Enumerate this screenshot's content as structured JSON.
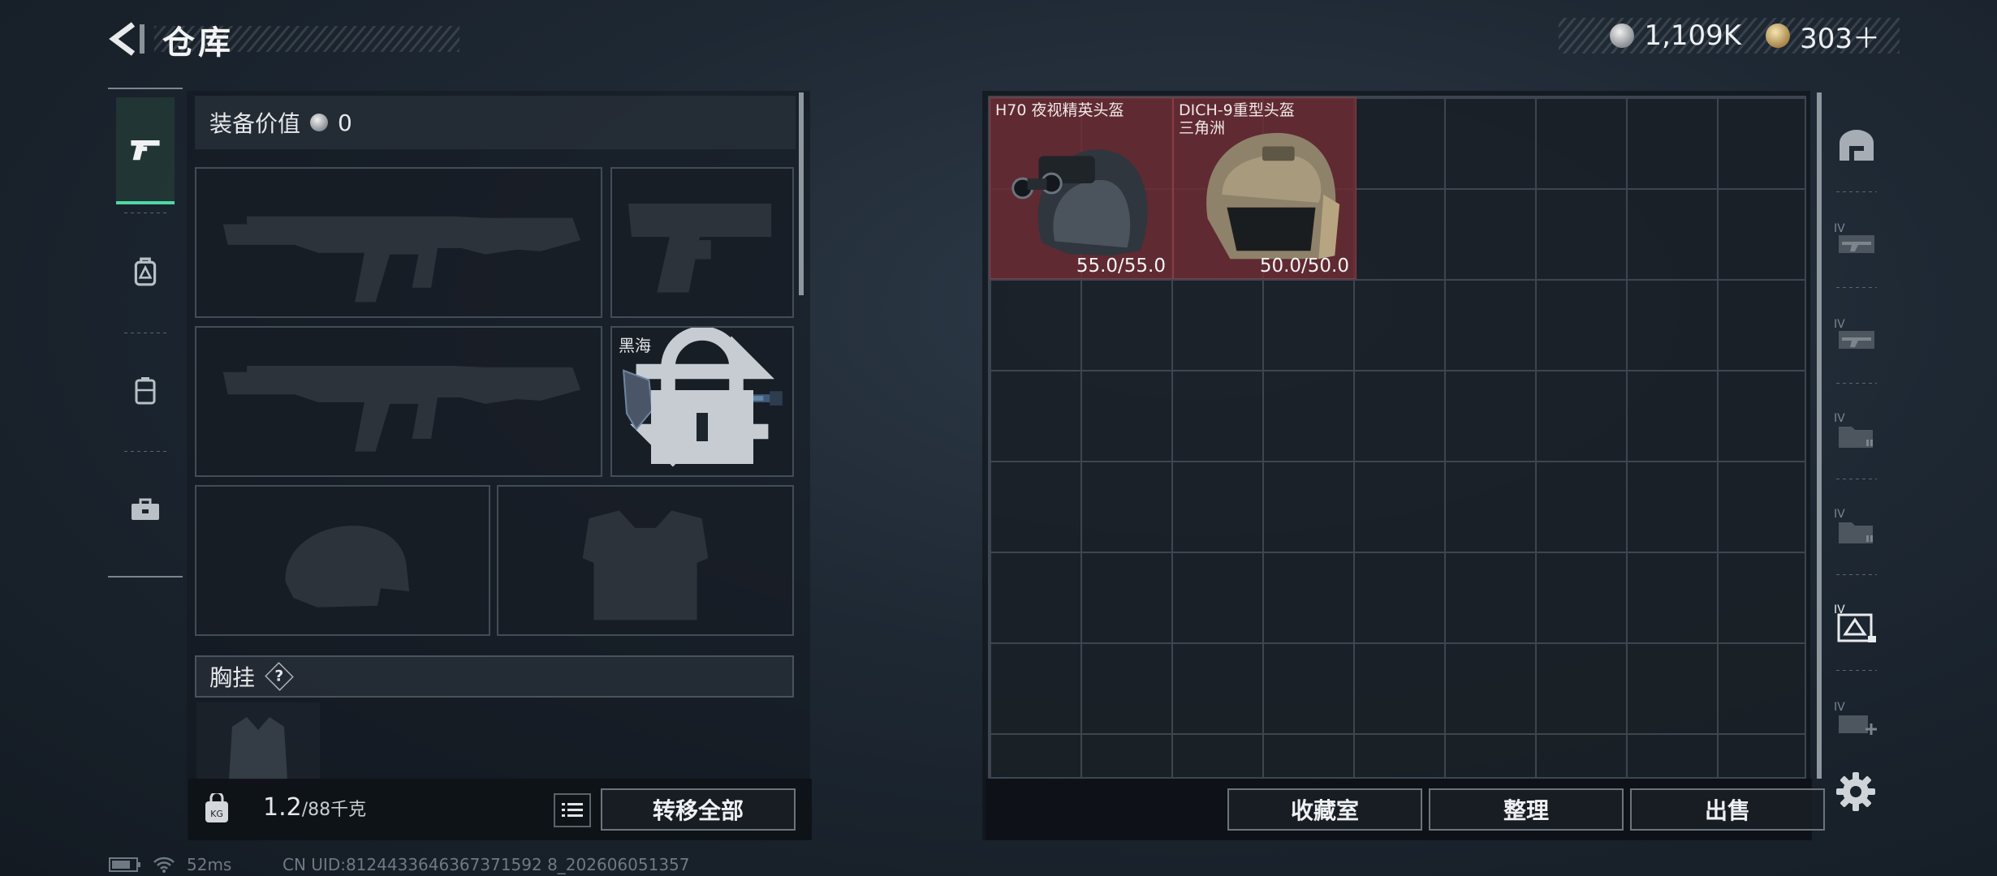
{
  "header": {
    "title": "仓库"
  },
  "currency": [
    {
      "icon": "silver-coin-icon",
      "value": "1,109K"
    },
    {
      "icon": "gold-coin-icon",
      "value": "303＋"
    }
  ],
  "left_tabs": [
    {
      "name": "weapon-tab",
      "icon": "pistol-icon",
      "active": true
    },
    {
      "name": "backpack-tab",
      "icon": "backpack-icon",
      "active": false
    },
    {
      "name": "case-tab",
      "icon": "case-icon",
      "active": false
    },
    {
      "name": "toolbox-tab",
      "icon": "toolbox-icon",
      "active": false
    }
  ],
  "equipment": {
    "value_label": "装备价值",
    "value": "0",
    "melee_name": "黑海",
    "chest_rig_label": "胸挂",
    "chest_rig_help": "?"
  },
  "equip_footer": {
    "weight": "1.2",
    "capacity": "/88千克",
    "transfer_all": "转移全部"
  },
  "storage": {
    "items": [
      {
        "name": "H70 夜视精英头盔",
        "durability": "55.0/55.0",
        "icon": "night-vision-helmet-icon"
      },
      {
        "name": "DICH-9重型头盔\n三角洲",
        "durability": "50.0/50.0",
        "icon": "heavy-helmet-icon"
      }
    ],
    "buttons": {
      "collection": "收藏室",
      "organize": "整理",
      "sell": "出售"
    }
  },
  "right_tabs": [
    {
      "name": "storage-main-tab",
      "icon": "vault-icon",
      "level": ""
    },
    {
      "name": "storage-ext-1-tab",
      "icon": "weapon-rack-icon",
      "level": "IV"
    },
    {
      "name": "storage-ext-2-tab",
      "icon": "weapon-rack-icon",
      "level": "IV"
    },
    {
      "name": "storage-ext-3-tab",
      "icon": "folder-icon",
      "level": "IV"
    },
    {
      "name": "storage-ext-4-tab",
      "icon": "folder-icon",
      "level": "IV"
    },
    {
      "name": "storage-ext-5-tab",
      "icon": "gear-case-icon",
      "level": "IV"
    },
    {
      "name": "storage-add-tab",
      "icon": "add-storage-icon",
      "level": "IV"
    }
  ],
  "status": {
    "ping": "52ms",
    "uid": "CN UID:8124433646367371592 8_202606051357"
  }
}
